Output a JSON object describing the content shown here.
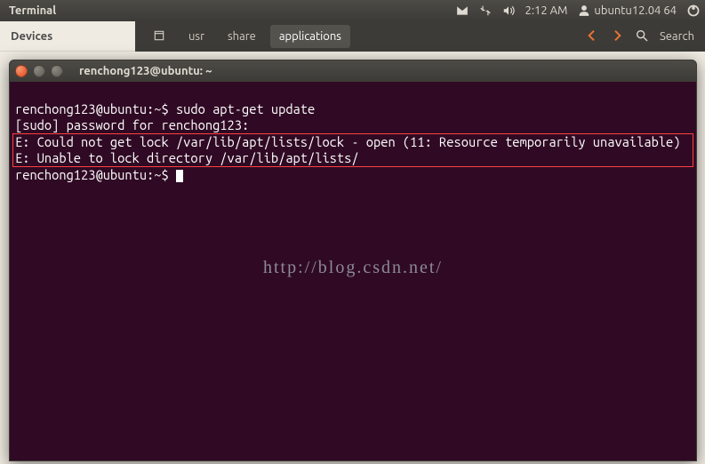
{
  "top_panel": {
    "title": "Terminal",
    "time": "2:12 AM",
    "user": "ubuntu12.04 64"
  },
  "nautilus": {
    "devices": "Devices",
    "crumbs": {
      "usr": "usr",
      "share": "share",
      "applications": "applications"
    },
    "search": "Search"
  },
  "terminal": {
    "title": "renchong123@ubuntu: ~",
    "line1_prompt": "renchong123@ubuntu:~$ ",
    "line1_cmd": "sudo apt-get update",
    "line2": "[sudo] password for renchong123:",
    "err1": "E: Could not get lock /var/lib/apt/lists/lock - open (11: Resource temporarily unavailable)",
    "err2": "E: Unable to lock directory /var/lib/apt/lists/",
    "line_last_prompt": "renchong123@ubuntu:~$ ",
    "watermark": "http://blog.csdn.net/"
  }
}
